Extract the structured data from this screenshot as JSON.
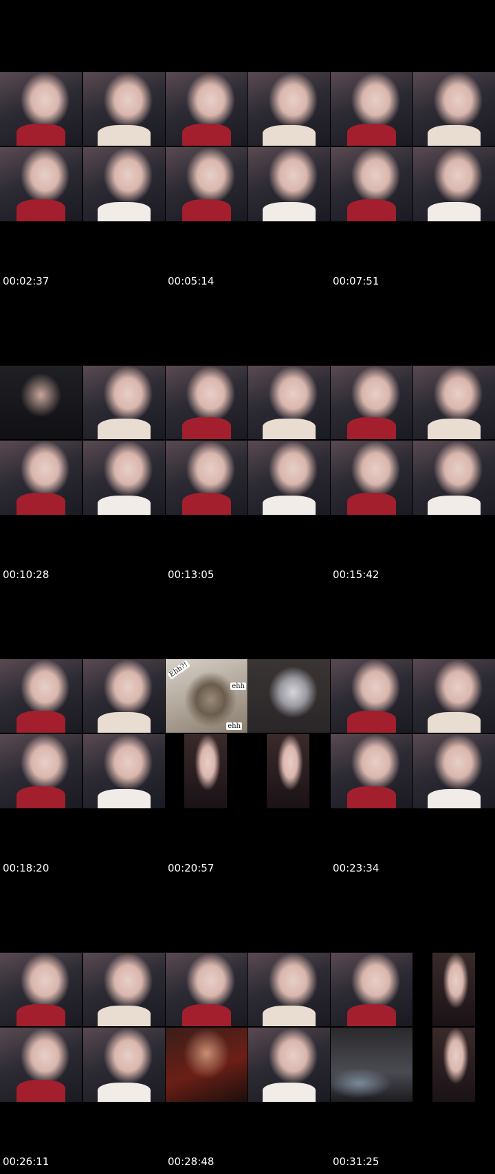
{
  "timestamps": [
    "00:02:37",
    "00:05:14",
    "00:07:51",
    "00:10:28",
    "00:13:05",
    "00:15:42",
    "00:18:20",
    "00:20:57",
    "00:23:34",
    "00:26:11",
    "00:28:48",
    "00:31:25"
  ],
  "captions": {
    "cat_top": "Ehh?!",
    "cat_side": "ehh",
    "cat_bottom": "ehh"
  }
}
